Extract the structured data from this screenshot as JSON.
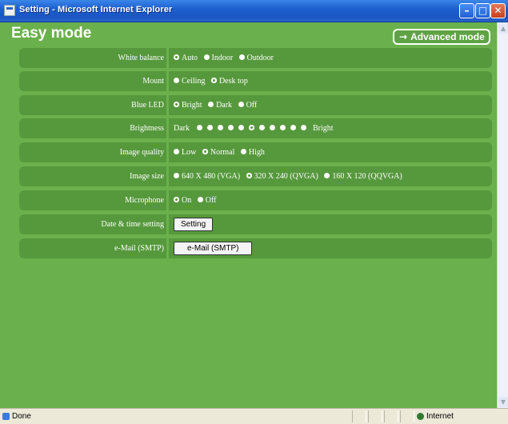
{
  "window": {
    "title": "Setting - Microsoft Internet Explorer",
    "minimize": "–",
    "maximize": "□",
    "close": "✕"
  },
  "page": {
    "title": "Easy mode",
    "advanced_button": "Advanced mode",
    "advanced_arrow": "→"
  },
  "settings": {
    "white_balance": {
      "label": "White balance",
      "options": [
        "Auto",
        "Indoor",
        "Outdoor"
      ],
      "selected": "Auto"
    },
    "mount": {
      "label": "Mount",
      "options": [
        "Ceiling",
        "Desk top"
      ],
      "selected": "Desk top"
    },
    "blue_led": {
      "label": "Blue LED",
      "options": [
        "Bright",
        "Dark",
        "Off"
      ],
      "selected": "Bright"
    },
    "brightness": {
      "label": "Brightness",
      "min_label": "Dark",
      "max_label": "Bright",
      "levels": 11,
      "selected_level": 6
    },
    "image_quality": {
      "label": "Image quality",
      "options": [
        "Low",
        "Normal",
        "High"
      ],
      "selected": "Normal"
    },
    "image_size": {
      "label": "Image size",
      "options": [
        "640 X 480 (VGA)",
        "320 X 240 (QVGA)",
        "160 X 120 (QQVGA)"
      ],
      "selected": "320 X 240 (QVGA)"
    },
    "microphone": {
      "label": "Microphone",
      "options": [
        "On",
        "Off"
      ],
      "selected": "On"
    },
    "date_time": {
      "label": "Date & time setting",
      "button": "Setting"
    },
    "email": {
      "label": "e-Mail (SMTP)",
      "button": "e-Mail (SMTP)"
    }
  },
  "statusbar": {
    "status": "Done",
    "zone": "Internet"
  },
  "colors": {
    "background": "#6ab04c",
    "row": "#56983c",
    "titlebar": "#1d5fd0"
  }
}
